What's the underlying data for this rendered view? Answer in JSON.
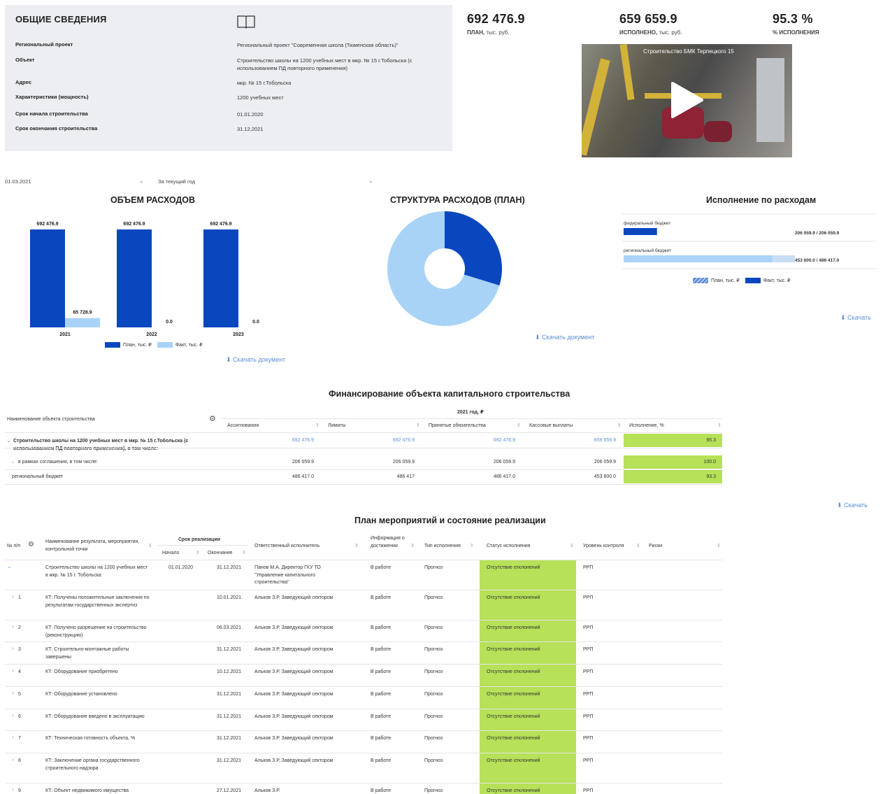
{
  "info": {
    "title": "ОБЩИЕ СВЕДЕНИЯ",
    "rows": [
      {
        "label": "Региональный проект",
        "value": "Региональный проект \"Современная школа (Тюменская область)\""
      },
      {
        "label": "Объект",
        "value": "Строительство школы на 1200 учебных мест в мкр. № 15 г.Тобольска (с использованием ПД повторного применения)"
      },
      {
        "label": "Адрес",
        "value": "мкр. № 15 г.Тобольска"
      },
      {
        "label": "Характеристики (мощность)",
        "value": "1200 учебных мест"
      },
      {
        "label": "Срок начала строительства",
        "value": "01.01.2020"
      },
      {
        "label": "Срок окончания строительства",
        "value": "31.12.2021"
      }
    ]
  },
  "kpis": [
    {
      "value": "692 476.9",
      "caption_bold": "ПЛАН,",
      "caption": " тыс. руб."
    },
    {
      "value": "659 659.9",
      "caption_bold": "ИСПОЛНЕНО,",
      "caption": " тыс. руб."
    },
    {
      "value": "95.3 %",
      "caption_bold": "% ИСПОЛНЕНИЯ",
      "caption": ""
    }
  ],
  "video": {
    "caption": "Строительство БМК Терпецкого 15"
  },
  "filters": {
    "date": "01.03.2021",
    "period": "За текущий год"
  },
  "colors": {
    "plan": "#0a47bf",
    "fact": "#a8d3f7",
    "green": "#b6e158",
    "link": "#5b8fd6"
  },
  "expenses": {
    "title": "ОБЪЕМ РАСХОДОВ",
    "download": "Скачать документ",
    "legend_plan": "План, тыс. ₽",
    "legend_fact": "Факт, тыс. ₽"
  },
  "structure": {
    "title": "СТРУКТУРА РАСХОДОВ (ПЛАН)",
    "download": "Скачать документ"
  },
  "execution": {
    "title": "Исполнение по расходам",
    "download": "Скачать",
    "legend_plan": "План, тыс. ₽",
    "legend_fact": "Факт, тыс. ₽"
  },
  "chart_data": [
    {
      "type": "bar",
      "title": "ОБЪЕМ РАСХОДОВ",
      "categories": [
        "2021",
        "2022",
        "2023"
      ],
      "series": [
        {
          "name": "План, тыс. ₽",
          "values": [
            692476.9,
            692476.9,
            692476.9
          ],
          "labels": [
            "692 476.9",
            "692 476.9",
            "692 476.9"
          ]
        },
        {
          "name": "Факт, тыс. ₽",
          "values": [
            65728.9,
            0.0,
            0.0
          ],
          "labels": [
            "65 728.9",
            "0.0",
            "0.0"
          ]
        }
      ],
      "ylim": [
        0,
        692476.9
      ],
      "legend": "bottom"
    },
    {
      "type": "pie",
      "title": "СТРУКТУРА РАСХОДОВ (ПЛАН)",
      "labels": [
        "федеральный бюджет",
        "региональный бюджет"
      ],
      "values": [
        206059.9,
        486417.0
      ],
      "donut": true
    },
    {
      "type": "bar",
      "title": "Исполнение по расходам",
      "orientation": "horizontal",
      "categories": [
        "федеральный бюджет",
        "региональный бюджет"
      ],
      "series": [
        {
          "name": "План, тыс. ₽",
          "values": [
            206059.9,
            486417.0
          ]
        },
        {
          "name": "Факт, тыс. ₽",
          "values": [
            206059.9,
            453600.0
          ]
        }
      ],
      "value_labels": [
        "206 059.9 / 206 059.9",
        "453 600.0 / 486 417.0"
      ],
      "legend": "bottom"
    }
  ],
  "financing": {
    "title": "Финансирование объекта капитального строительства",
    "name_header": "Наименование объекта строительства",
    "year_header": "2021 год, ₽",
    "columns": [
      "Ассигнования",
      "Лимиты",
      "Принятые обязательства",
      "Кассовые выплаты",
      "Исполнение, %"
    ],
    "rows": [
      {
        "name": "Строительство школы на 1200 учебных мест в мкр. № 15 г.Тобольска (с использованием ПД повторного применения), в том числе:",
        "values": [
          "692 476.9",
          "692 476.9",
          "692 476.9",
          "659 659.9",
          "95.3"
        ]
      },
      {
        "name": "в рамках соглашения, в том числе:",
        "values": [
          "206 059.9",
          "206 059.9",
          "206 059.9",
          "206 059.9",
          "100.0"
        ]
      },
      {
        "name": "региональный бюджет",
        "values": [
          "486 417.0",
          "486 417",
          "486 417.0",
          "453 600.0",
          "93.3"
        ]
      }
    ],
    "download": "Скачать"
  },
  "plan": {
    "title": "План мероприятий и состояние реализации",
    "headers": {
      "num": "№ п/п",
      "name": "Наименование результата, мероприятия, контрольной точки",
      "period": "Срок реализации",
      "start": "Начало",
      "end": "Окончание",
      "responsible": "Ответственный исполнитель",
      "info": "Информация о достижении",
      "type": "Тип исполнения",
      "status": "Статус исполнения",
      "level": "Уровень контроля",
      "risks": "Риски"
    },
    "rows": [
      {
        "num": "",
        "name": "Строительство школы на 1200 учебных мест в мкр. № 15 г. Тобольска",
        "start": "01.01.2020",
        "end": "31.12.2021",
        "responsible": "Панов М.А. Директор ГКУ ТО \"Управление капитального строительства\"",
        "info": "В работе",
        "type": "Прогноз",
        "status": "Отсутствие отклонений",
        "level": "РРП"
      },
      {
        "num": "1",
        "name": "КТ: Получены положительные заключения по результатам государственных экспертиз",
        "start": "",
        "end": "10.01.2021",
        "responsible": "Альков З.Р. Заведующий сектором",
        "info": "В работе",
        "type": "Прогноз",
        "status": "Отсутствие отклонений",
        "level": "РРП"
      },
      {
        "num": "2",
        "name": "КТ: Получено разрешение на строительство (реконструкцию)",
        "start": "",
        "end": "06.03.2021",
        "responsible": "Альков З.Р. Заведующий сектором",
        "info": "В работе",
        "type": "Прогноз",
        "status": "Отсутствие отклонений",
        "level": "РРП"
      },
      {
        "num": "3",
        "name": "КТ: Строительно-монтажные работы завершены",
        "start": "",
        "end": "31.12.2021",
        "responsible": "Альков З.Р. Заведующий сектором",
        "info": "В работе",
        "type": "Прогноз",
        "status": "Отсутствие отклонений",
        "level": "РРП"
      },
      {
        "num": "4",
        "name": "КТ: Оборудование приобретено",
        "start": "",
        "end": "10.12.2021",
        "responsible": "Альков З.Р. Заведующий сектором",
        "info": "В работе",
        "type": "Прогноз",
        "status": "Отсутствие отклонений",
        "level": "РРП"
      },
      {
        "num": "5",
        "name": "КТ: Оборудование установлено",
        "start": "",
        "end": "31.12.2021",
        "responsible": "Альков З.Р. Заведующий сектором",
        "info": "В работе",
        "type": "Прогноз",
        "status": "Отсутствие отклонений",
        "level": "РРП"
      },
      {
        "num": "6",
        "name": "КТ: Оборудование введено в эксплуатацию",
        "start": "",
        "end": "31.12.2021",
        "responsible": "Альков З.Р. Заведующий сектором",
        "info": "В работе",
        "type": "Прогноз",
        "status": "Отсутствие отклонений",
        "level": "РРП"
      },
      {
        "num": "7",
        "name": "КТ: Техническая готовность объекта, %",
        "start": "",
        "end": "31.12.2021",
        "responsible": "Альков З.Р. Заведующий сектором",
        "info": "В работе",
        "type": "Прогноз",
        "status": "Отсутствие отклонений",
        "level": "РРП"
      },
      {
        "num": "8",
        "name": "КТ: Заключение органа государственного строительного надзора",
        "start": "",
        "end": "31.12.2021",
        "responsible": "Альков З.Р. Заведующий сектором",
        "info": "В работе",
        "type": "Прогноз",
        "status": "Отсутствие отклонений",
        "level": "РРП"
      },
      {
        "num": "9",
        "name": "КТ: Объект недвижимого имущества",
        "start": "",
        "end": "27.12.2021",
        "responsible": "Альков З.Р.",
        "info": "В работе",
        "type": "Прогноз",
        "status": "Отсутствие отклонений",
        "level": "РРП"
      }
    ]
  }
}
